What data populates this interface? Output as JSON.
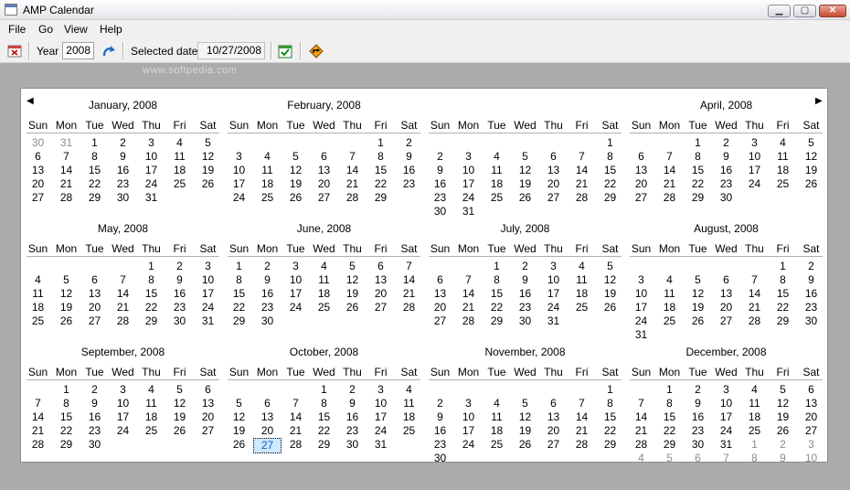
{
  "window": {
    "title": "AMP Calendar",
    "minimize": "▁",
    "maximize": "▢",
    "close": "✕"
  },
  "menu": [
    {
      "label": "File"
    },
    {
      "label": "Go"
    },
    {
      "label": "View"
    },
    {
      "label": "Help"
    }
  ],
  "toolbar": {
    "year_label": "Year",
    "year_value": "2008",
    "selected_label": "Selected date",
    "selected_value": "10/27/2008"
  },
  "watermark": "www.softpedia.com",
  "weekdays": [
    "Sun",
    "Mon",
    "Tue",
    "Wed",
    "Thu",
    "Fri",
    "Sat"
  ],
  "nav": {
    "prev": "◀",
    "next": "▶"
  },
  "months": [
    {
      "title": "January, 2008",
      "weeks": [
        [
          "30",
          "31",
          "1",
          "2",
          "3",
          "4",
          "5"
        ],
        [
          "6",
          "7",
          "8",
          "9",
          "10",
          "11",
          "12"
        ],
        [
          "13",
          "14",
          "15",
          "16",
          "17",
          "18",
          "19"
        ],
        [
          "20",
          "21",
          "22",
          "23",
          "24",
          "25",
          "26"
        ],
        [
          "27",
          "28",
          "29",
          "30",
          "31",
          "",
          ""
        ]
      ],
      "first_lead": 2
    },
    {
      "title": "February, 2008",
      "weeks": [
        [
          "",
          "",
          "",
          "",
          "",
          "1",
          "2"
        ],
        [
          "3",
          "4",
          "5",
          "6",
          "7",
          "8",
          "9"
        ],
        [
          "10",
          "11",
          "12",
          "13",
          "14",
          "15",
          "16"
        ],
        [
          "17",
          "18",
          "19",
          "20",
          "21",
          "22",
          "23"
        ],
        [
          "24",
          "25",
          "26",
          "27",
          "28",
          "29",
          ""
        ]
      ],
      "first_lead": 0
    },
    {
      "title": "",
      "weeks": [
        [
          "",
          "",
          "",
          "",
          "",
          "",
          "1"
        ],
        [
          "2",
          "3",
          "4",
          "5",
          "6",
          "7",
          "8"
        ],
        [
          "9",
          "10",
          "11",
          "12",
          "13",
          "14",
          "15"
        ],
        [
          "16",
          "17",
          "18",
          "19",
          "20",
          "21",
          "22"
        ],
        [
          "23",
          "24",
          "25",
          "26",
          "27",
          "28",
          "29"
        ],
        [
          "30",
          "31",
          "",
          "",
          "",
          "",
          ""
        ]
      ],
      "first_lead": 0
    },
    {
      "title": "April, 2008",
      "weeks": [
        [
          "",
          "",
          "1",
          "2",
          "3",
          "4",
          "5"
        ],
        [
          "6",
          "7",
          "8",
          "9",
          "10",
          "11",
          "12"
        ],
        [
          "13",
          "14",
          "15",
          "16",
          "17",
          "18",
          "19"
        ],
        [
          "20",
          "21",
          "22",
          "23",
          "24",
          "25",
          "26"
        ],
        [
          "27",
          "28",
          "29",
          "30",
          "",
          "",
          ""
        ]
      ],
      "first_lead": 0
    },
    {
      "title": "May, 2008",
      "weeks": [
        [
          "",
          "",
          "",
          "",
          "1",
          "2",
          "3"
        ],
        [
          "4",
          "5",
          "6",
          "7",
          "8",
          "9",
          "10"
        ],
        [
          "11",
          "12",
          "13",
          "14",
          "15",
          "16",
          "17"
        ],
        [
          "18",
          "19",
          "20",
          "21",
          "22",
          "23",
          "24"
        ],
        [
          "25",
          "26",
          "27",
          "28",
          "29",
          "30",
          "31"
        ]
      ],
      "first_lead": 0
    },
    {
      "title": "June, 2008",
      "weeks": [
        [
          "1",
          "2",
          "3",
          "4",
          "5",
          "6",
          "7"
        ],
        [
          "8",
          "9",
          "10",
          "11",
          "12",
          "13",
          "14"
        ],
        [
          "15",
          "16",
          "17",
          "18",
          "19",
          "20",
          "21"
        ],
        [
          "22",
          "23",
          "24",
          "25",
          "26",
          "27",
          "28"
        ],
        [
          "29",
          "30",
          "",
          "",
          "",
          "",
          ""
        ]
      ],
      "first_lead": 0
    },
    {
      "title": "July, 2008",
      "weeks": [
        [
          "",
          "",
          "1",
          "2",
          "3",
          "4",
          "5"
        ],
        [
          "6",
          "7",
          "8",
          "9",
          "10",
          "11",
          "12"
        ],
        [
          "13",
          "14",
          "15",
          "16",
          "17",
          "18",
          "19"
        ],
        [
          "20",
          "21",
          "22",
          "23",
          "24",
          "25",
          "26"
        ],
        [
          "27",
          "28",
          "29",
          "30",
          "31",
          "",
          ""
        ]
      ],
      "first_lead": 0
    },
    {
      "title": "August, 2008",
      "weeks": [
        [
          "",
          "",
          "",
          "",
          "",
          "1",
          "2"
        ],
        [
          "3",
          "4",
          "5",
          "6",
          "7",
          "8",
          "9"
        ],
        [
          "10",
          "11",
          "12",
          "13",
          "14",
          "15",
          "16"
        ],
        [
          "17",
          "18",
          "19",
          "20",
          "21",
          "22",
          "23"
        ],
        [
          "24",
          "25",
          "26",
          "27",
          "28",
          "29",
          "30"
        ],
        [
          "31",
          "",
          "",
          "",
          "",
          "",
          ""
        ]
      ],
      "first_lead": 0
    },
    {
      "title": "September, 2008",
      "weeks": [
        [
          "",
          "1",
          "2",
          "3",
          "4",
          "5",
          "6"
        ],
        [
          "7",
          "8",
          "9",
          "10",
          "11",
          "12",
          "13"
        ],
        [
          "14",
          "15",
          "16",
          "17",
          "18",
          "19",
          "20"
        ],
        [
          "21",
          "22",
          "23",
          "24",
          "25",
          "26",
          "27"
        ],
        [
          "28",
          "29",
          "30",
          "",
          "",
          "",
          ""
        ]
      ],
      "first_lead": 0
    },
    {
      "title": "October, 2008",
      "weeks": [
        [
          "",
          "",
          "",
          "1",
          "2",
          "3",
          "4"
        ],
        [
          "5",
          "6",
          "7",
          "8",
          "9",
          "10",
          "11"
        ],
        [
          "12",
          "13",
          "14",
          "15",
          "16",
          "17",
          "18"
        ],
        [
          "19",
          "20",
          "21",
          "22",
          "23",
          "24",
          "25"
        ],
        [
          "26",
          "27",
          "28",
          "29",
          "30",
          "31",
          ""
        ]
      ],
      "first_lead": 0,
      "selected": "27"
    },
    {
      "title": "November, 2008",
      "weeks": [
        [
          "",
          "",
          "",
          "",
          "",
          "",
          "1"
        ],
        [
          "2",
          "3",
          "4",
          "5",
          "6",
          "7",
          "8"
        ],
        [
          "9",
          "10",
          "11",
          "12",
          "13",
          "14",
          "15"
        ],
        [
          "16",
          "17",
          "18",
          "19",
          "20",
          "21",
          "22"
        ],
        [
          "23",
          "24",
          "25",
          "26",
          "27",
          "28",
          "29"
        ],
        [
          "30",
          "",
          "",
          "",
          "",
          "",
          ""
        ]
      ],
      "first_lead": 0
    },
    {
      "title": "December, 2008",
      "weeks": [
        [
          "",
          "1",
          "2",
          "3",
          "4",
          "5",
          "6"
        ],
        [
          "7",
          "8",
          "9",
          "10",
          "11",
          "12",
          "13"
        ],
        [
          "14",
          "15",
          "16",
          "17",
          "18",
          "19",
          "20"
        ],
        [
          "21",
          "22",
          "23",
          "24",
          "25",
          "26",
          "27"
        ],
        [
          "28",
          "29",
          "30",
          "31",
          "1",
          "2",
          "3"
        ],
        [
          "4",
          "5",
          "6",
          "7",
          "8",
          "9",
          "10"
        ]
      ],
      "first_lead": 0,
      "trail_from": "4,4"
    }
  ]
}
